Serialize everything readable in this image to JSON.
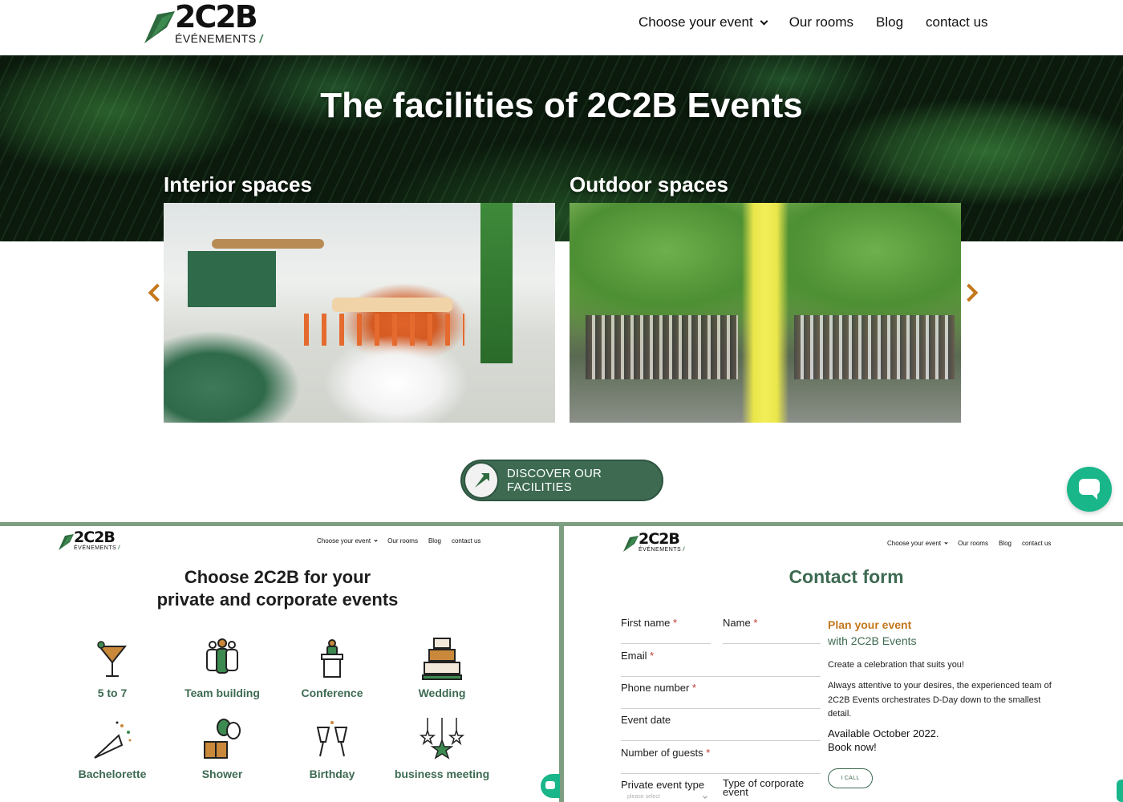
{
  "colors": {
    "brand_green": "#3d6a51",
    "accent_orange": "#c4771c",
    "divider": "#7e9e82",
    "chat_teal": "#19b68a"
  },
  "main": {
    "logo": {
      "brand": "2C2B",
      "sub": "ÉVÉNEMENTS",
      "slash": "/"
    },
    "nav": {
      "choose_event": "Choose your event",
      "our_rooms": "Our rooms",
      "blog": "Blog",
      "contact_us": "contact us"
    },
    "hero_title": "The facilities of 2C2B Events",
    "slides": [
      {
        "label": "Interior spaces"
      },
      {
        "label": "Outdoor spaces"
      }
    ],
    "discover_button": "DISCOVER OUR FACILITIES"
  },
  "left_panel": {
    "logo": {
      "brand": "2C2B",
      "sub": "ÉVÉNEMENTS",
      "slash": "/"
    },
    "nav": {
      "choose_event": "Choose your event",
      "our_rooms": "Our rooms",
      "blog": "Blog",
      "contact_us": "contact us"
    },
    "title_line1": "Choose 2C2B for your",
    "title_line2": "private and corporate events",
    "events": [
      {
        "label": "5 to 7",
        "icon": "cocktail-icon"
      },
      {
        "label": "Team building",
        "icon": "team-icon"
      },
      {
        "label": "Conference",
        "icon": "podium-icon"
      },
      {
        "label": "Wedding",
        "icon": "wedding-cake-icon"
      },
      {
        "label": "Bachelorette",
        "icon": "party-popper-icon"
      },
      {
        "label": "Shower",
        "icon": "gift-balloons-icon"
      },
      {
        "label": "Birthday",
        "icon": "champagne-glasses-icon"
      },
      {
        "label": "business meeting",
        "icon": "hanging-stars-icon"
      }
    ]
  },
  "right_panel": {
    "logo": {
      "brand": "2C2B",
      "sub": "ÉVÉNEMENTS",
      "slash": "/"
    },
    "nav": {
      "choose_event": "Choose your event",
      "our_rooms": "Our rooms",
      "blog": "Blog",
      "contact_us": "contact us"
    },
    "title": "Contact form",
    "form": {
      "first_name": "First name",
      "name": "Name",
      "email": "Email",
      "phone": "Phone number",
      "event_date": "Event date",
      "guests": "Number of guests",
      "private_type": "Private event type",
      "private_type_placeholder": "please select",
      "corporate_type_line1": "Type of corporate",
      "corporate_type_line2": "event",
      "required_mark": "*"
    },
    "plan_title": "Plan your event",
    "plan_sub": "with 2C2B Events",
    "plan_p1": "Create a celebration that suits you!",
    "plan_p2": "Always attentive to your desires, the experienced team of 2C2B Events orchestrates D-Day down to the smallest detail.",
    "plan_avail_line1": "Available October 2022.",
    "plan_avail_line2": "Book now!",
    "call_button": "I CALL"
  }
}
